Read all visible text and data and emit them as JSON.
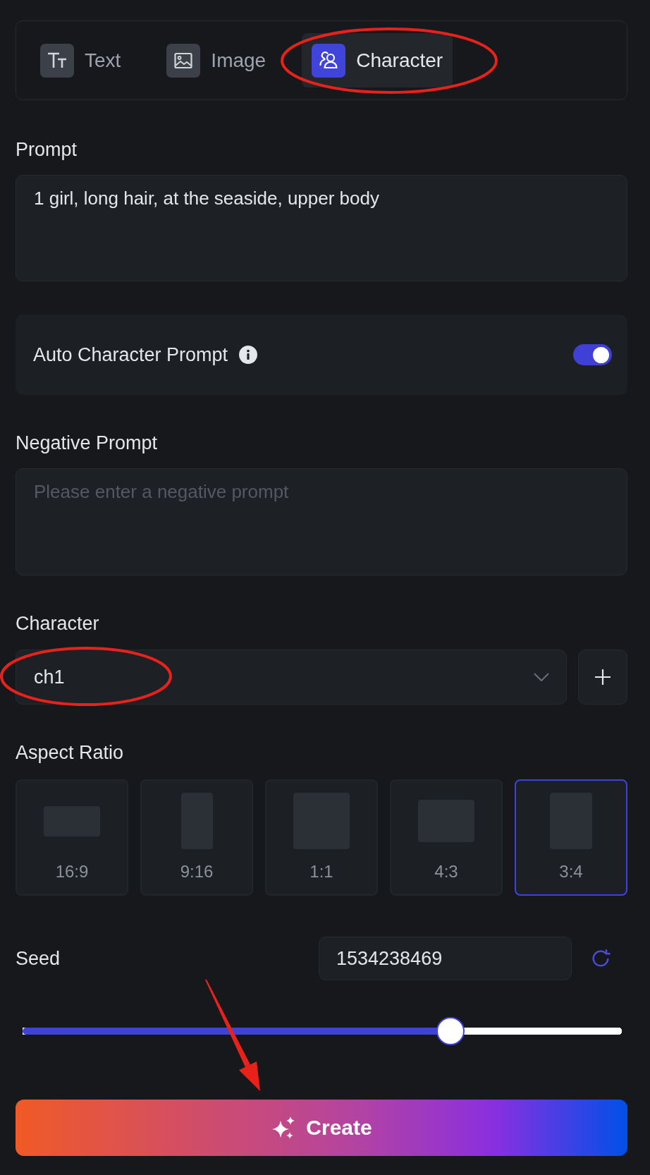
{
  "tabs": [
    {
      "label": "Text",
      "kind": "text",
      "selected": false
    },
    {
      "label": "Image",
      "kind": "image",
      "selected": false
    },
    {
      "label": "Character",
      "kind": "character",
      "selected": true
    }
  ],
  "prompt": {
    "label": "Prompt",
    "value": "1 girl, long hair, at the seaside, upper body"
  },
  "auto_character_prompt": {
    "label": "Auto Character Prompt",
    "on": true
  },
  "negative_prompt": {
    "label": "Negative Prompt",
    "placeholder": "Please enter a negative prompt"
  },
  "character": {
    "label": "Character",
    "value": "ch1"
  },
  "aspect_ratio": {
    "label": "Aspect Ratio",
    "options": [
      {
        "label": "16:9",
        "selected": false
      },
      {
        "label": "9:16",
        "selected": false
      },
      {
        "label": "1:1",
        "selected": false
      },
      {
        "label": "4:3",
        "selected": false
      },
      {
        "label": "3:4",
        "selected": true
      }
    ]
  },
  "seed": {
    "label": "Seed",
    "value": "1534238469"
  },
  "slider": {
    "level": 0.714
  },
  "create_button": {
    "label": "Create"
  }
}
